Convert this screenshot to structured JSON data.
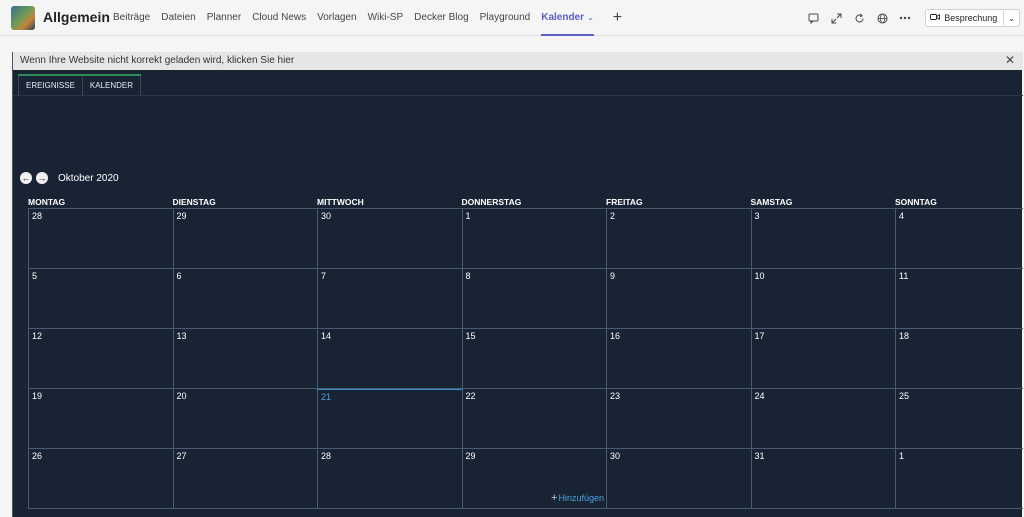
{
  "header": {
    "team_name": "Allgemein",
    "tabs": [
      "Beiträge",
      "Dateien",
      "Planner",
      "Cloud News",
      "Vorlagen",
      "Wiki-SP",
      "Decker Blog",
      "Playground"
    ],
    "active_tab": "Kalender",
    "add_tab_symbol": "+",
    "meeting_button": "Besprechung"
  },
  "banner": {
    "text": "Wenn Ihre Website nicht korrekt geladen wird, klicken Sie hier",
    "close": "✕"
  },
  "sharepoint": {
    "tabs": [
      "EREIGNISSE",
      "KALENDER"
    ]
  },
  "calendar": {
    "month": "Oktober 2020",
    "weekdays": [
      "MONTAG",
      "DIENSTAG",
      "MITTWOCH",
      "DONNERSTAG",
      "FREITAG",
      "SAMSTAG",
      "SONNTAG"
    ],
    "weeks": [
      [
        "28",
        "29",
        "30",
        "1",
        "2",
        "3",
        "4"
      ],
      [
        "5",
        "6",
        "7",
        "8",
        "9",
        "10",
        "11"
      ],
      [
        "12",
        "13",
        "14",
        "15",
        "16",
        "17",
        "18"
      ],
      [
        "19",
        "20",
        "21",
        "22",
        "23",
        "24",
        "25"
      ],
      [
        "26",
        "27",
        "28",
        "29",
        "30",
        "31",
        "1"
      ]
    ],
    "today": "21",
    "add_label": "Hinzufügen",
    "accent_color": "#4aa0e0",
    "background_color": "#182334"
  },
  "icons": {
    "chat": "chat-icon",
    "expand": "expand-icon",
    "refresh": "refresh-icon",
    "globe": "globe-icon",
    "more": "more-icon",
    "video": "video-camera-icon",
    "prev": "arrow-left-icon",
    "next": "arrow-right-icon"
  }
}
